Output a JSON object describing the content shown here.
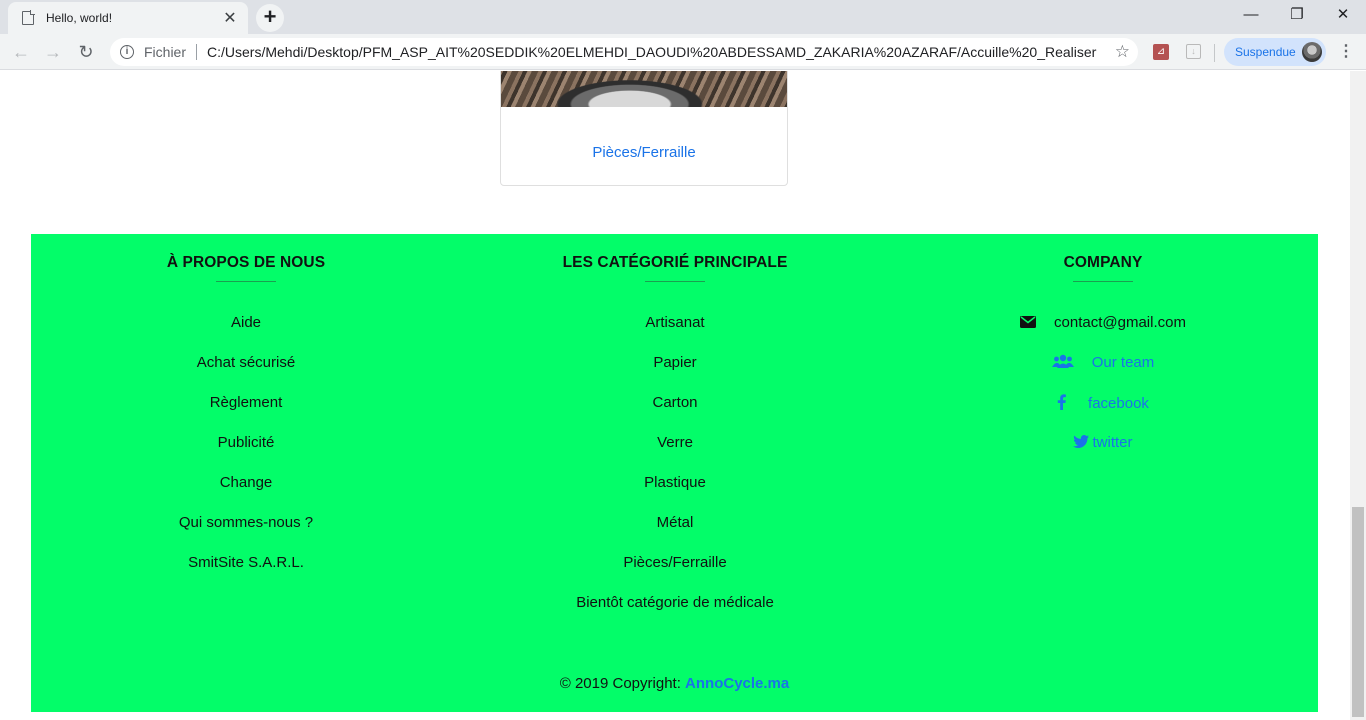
{
  "browser": {
    "tab_title": "Hello, world!",
    "tab_close": "✕",
    "new_tab": "+",
    "minimize": "—",
    "restore": "❐",
    "close": "✕",
    "back": "←",
    "forward": "→",
    "reload": "↻",
    "info_glyph": "i",
    "url_label": "Fichier",
    "url": "C:/Users/Mehdi/Desktop/PFM_ASP_AIT%20SEDDIK%20ELMEHDI_DAOUDI%20ABDESSAMD_ZAKARIA%20AZARAF/Accuille%20_Realiser%20par...",
    "star": "☆",
    "profile_status": "Suspendue",
    "menu": "⋮"
  },
  "card": {
    "title": "Pièces/Ferraille"
  },
  "footer": {
    "about": {
      "heading": "À PROPOS DE NOUS",
      "items": [
        "Aide",
        "Achat sécurisé",
        "Règlement",
        "Publicité",
        "Change",
        "Qui sommes-nous ?",
        "SmitSite S.A.R.L."
      ]
    },
    "categories": {
      "heading": "LES CATÉGORIÉ PRINCIPALE",
      "items": [
        "Artisanat",
        "Papier",
        "Carton",
        "Verre",
        "Plastique",
        "Métal",
        "Pièces/Ferraille",
        "Bientôt catégorie de médicale"
      ]
    },
    "company": {
      "heading": "COMPANY",
      "items": [
        {
          "icon": "envelope-icon",
          "label": "contact@gmail.com"
        },
        {
          "icon": "users-icon",
          "label": "Our team"
        },
        {
          "icon": "facebook-icon",
          "label": "facebook"
        },
        {
          "icon": "twitter-icon",
          "label": "twitter"
        }
      ]
    },
    "copyright_text": "© 2019 Copyright: ",
    "copyright_link": "AnnoCycle.ma"
  },
  "colors": {
    "footer_bg": "#03fd69",
    "link": "#1a73e8"
  }
}
